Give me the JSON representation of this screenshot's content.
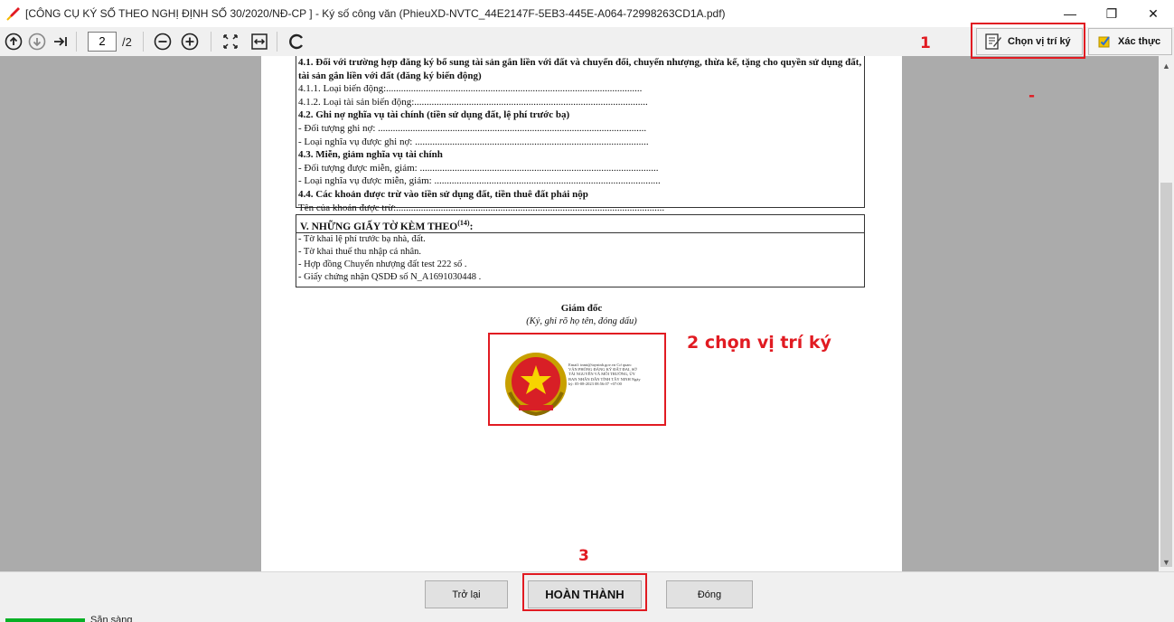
{
  "window": {
    "title": "[CÔNG CỤ KÝ SỐ THEO NGHỊ ĐỊNH SỐ 30/2020/NĐ-CP ] - Ký số công văn (PhieuXD-NVTC_44E2147F-5EB3-445E-A064-72998263CD1A.pdf)",
    "controls": [
      "—",
      "❐",
      "✕"
    ]
  },
  "toolbar": {
    "page_current": "2",
    "page_total": "/2",
    "choose_position_label": "Chọn vị trí ký",
    "verify_label": "Xác thực"
  },
  "annotations": {
    "step1": "1",
    "step2": "2 chọn vị trí ký",
    "step3": "3",
    "dash": "-"
  },
  "document": {
    "section4_lines": [
      {
        "bold": true,
        "text": "4.1. Đối với trường hợp đăng ký bổ sung tài sản gắn liền với đất và chuyển đổi, chuyển nhượng, thừa kế, tặng cho quyền sử dụng đất, tài sản gắn liền với đất (đăng ký biến động)"
      },
      {
        "bold": false,
        "text": "4.1.1. Loại biến động:......................................................................................................."
      },
      {
        "bold": false,
        "text": "4.1.2. Loại tài sản biến động:.............................................................................................."
      },
      {
        "bold": true,
        "text": "4.2. Ghi nợ nghĩa vụ tài chính (tiền sử dụng đất, lệ phí trước bạ)"
      },
      {
        "bold": false,
        "text": "- Đối tượng ghi nợ: ............................................................................................................"
      },
      {
        "bold": false,
        "text": "- Loại nghĩa vụ được ghi nợ: .............................................................................................."
      },
      {
        "bold": true,
        "text": "4.3. Miễn, giảm nghĩa vụ tài chính"
      },
      {
        "bold": false,
        "text": "- Đối tượng được miễn, giảm: ................................................................................................"
      },
      {
        "bold": false,
        "text": "- Loại nghĩa vụ được miễn, giảm: ..........................................................................................."
      },
      {
        "bold": true,
        "text": "4.4. Các khoản được trừ vào tiền sử dụng đất, tiền thuê đất phải nộp"
      },
      {
        "bold": false,
        "text": "Tên của khoản được trừ:............................................................................................................"
      }
    ],
    "section5_heading": "V. NHỮNG GIẤY TỜ KÈM THEO",
    "section5_sup": "(14)",
    "section5_colon": ":",
    "section5_items": [
      "- Tờ khai lệ phí trước bạ nhà, đất.",
      "- Tờ khai thuế thu nhập cá nhân.",
      "- Hợp đồng Chuyển nhượng đất test 222 số  .",
      "- Giấy chứng nhận QSDĐ số N_A1691030448 ."
    ],
    "signer_title": "Giám đốc",
    "signer_note": "(Ký, ghi rõ họ tên, đóng dấu)",
    "stamp_text": "Email: tnmt@tayninh.gov.vn Cơ quan: VĂN PHÒNG ĐĂNG KÝ ĐẤT ĐAI, SỞ TÀI NGUYÊN VÀ MÔI TRƯỜNG, ỦY BAN NHÂN DÂN TỈNH TÂY NINH Ngày ký: 05-08-2023 08:56:07 +07:00"
  },
  "footer": {
    "back_label": "Trở lại",
    "finish_label": "HOÀN THÀNH",
    "close_label": "Đóng"
  },
  "status": {
    "text": "Sẵn sàng"
  },
  "colors": {
    "annotation_red": "#e11b22",
    "viewer_gray": "#ababab",
    "progress_green": "#06b025"
  }
}
